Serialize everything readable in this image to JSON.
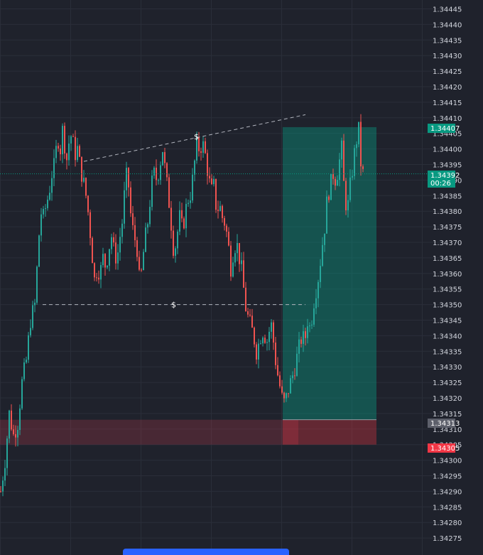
{
  "chart_data": {
    "type": "candlestick",
    "y_axis": {
      "ylim": [
        1.34273,
        1.34447
      ],
      "ticks": [
        "1.34445",
        "1.34440",
        "1.34435",
        "1.34430",
        "1.34425",
        "1.34420",
        "1.34415",
        "1.34410",
        "1.34405",
        "1.34400",
        "1.34395",
        "1.34390",
        "1.34385",
        "1.34380",
        "1.34375",
        "1.34370",
        "1.34365",
        "1.34360",
        "1.34355",
        "1.34350",
        "1.34345",
        "1.34340",
        "1.34335",
        "1.34330",
        "1.34325",
        "1.34320",
        "1.34315",
        "1.34310",
        "1.34305",
        "1.34300",
        "1.34295",
        "1.34290",
        "1.34285",
        "1.34280",
        "1.34275"
      ]
    },
    "price_badges": {
      "take_profit": "1.34407",
      "current": "1.34392",
      "countdown": "00:26",
      "entry": "1.34313",
      "stop_loss": "1.34305"
    },
    "close_path": [
      [
        0,
        1.3429
      ],
      [
        6,
        1.343
      ],
      [
        12,
        1.34315
      ],
      [
        18,
        1.34308
      ],
      [
        24,
        1.34312
      ],
      [
        30,
        1.34325
      ],
      [
        36,
        1.34332
      ],
      [
        42,
        1.34345
      ],
      [
        48,
        1.3435
      ],
      [
        52,
        1.34365
      ],
      [
        56,
        1.3438
      ],
      [
        60,
        1.34378
      ],
      [
        64,
        1.34382
      ],
      [
        68,
        1.34386
      ],
      [
        72,
        1.34392
      ],
      [
        76,
        1.34395
      ],
      [
        80,
        1.34404
      ],
      [
        84,
        1.344
      ],
      [
        88,
        1.34408
      ],
      [
        92,
        1.34395
      ],
      [
        96,
        1.34402
      ],
      [
        100,
        1.34405
      ],
      [
        104,
        1.34398
      ],
      [
        108,
        1.344
      ],
      [
        112,
        1.34394
      ],
      [
        116,
        1.3439
      ],
      [
        120,
        1.34385
      ],
      [
        124,
        1.34378
      ],
      [
        128,
        1.34368
      ],
      [
        132,
        1.34358
      ],
      [
        136,
        1.34362
      ],
      [
        140,
        1.3436
      ],
      [
        144,
        1.34365
      ],
      [
        148,
        1.34362
      ],
      [
        152,
        1.34368
      ],
      [
        156,
        1.34372
      ],
      [
        160,
        1.34366
      ],
      [
        164,
        1.34365
      ],
      [
        168,
        1.34372
      ],
      [
        172,
        1.34378
      ],
      [
        176,
        1.34392
      ],
      [
        180,
        1.34388
      ],
      [
        184,
        1.34376
      ],
      [
        188,
        1.34372
      ],
      [
        192,
        1.34368
      ],
      [
        196,
        1.34355
      ],
      [
        200,
        1.34365
      ],
      [
        204,
        1.34372
      ],
      [
        208,
        1.34378
      ],
      [
        212,
        1.34388
      ],
      [
        216,
        1.34392
      ],
      [
        220,
        1.3439
      ],
      [
        224,
        1.34395
      ],
      [
        228,
        1.344
      ],
      [
        232,
        1.34392
      ],
      [
        236,
        1.34385
      ],
      [
        240,
        1.34376
      ],
      [
        244,
        1.34366
      ],
      [
        248,
        1.34372
      ],
      [
        252,
        1.34378
      ],
      [
        256,
        1.34374
      ],
      [
        260,
        1.3438
      ],
      [
        264,
        1.34384
      ],
      [
        268,
        1.34386
      ],
      [
        272,
        1.34394
      ],
      [
        276,
        1.34401
      ],
      [
        280,
        1.344
      ],
      [
        284,
        1.34402
      ],
      [
        288,
        1.34398
      ],
      [
        292,
        1.34392
      ],
      [
        296,
        1.34386
      ],
      [
        300,
        1.34388
      ],
      [
        304,
        1.3438
      ],
      [
        308,
        1.34382
      ],
      [
        312,
        1.34378
      ],
      [
        316,
        1.34376
      ],
      [
        320,
        1.3437
      ],
      [
        324,
        1.34362
      ],
      [
        328,
        1.34368
      ],
      [
        332,
        1.3437
      ],
      [
        336,
        1.34365
      ],
      [
        340,
        1.3436
      ],
      [
        344,
        1.3435
      ],
      [
        348,
        1.34346
      ],
      [
        352,
        1.34343
      ],
      [
        356,
        1.3434
      ],
      [
        360,
        1.34335
      ],
      [
        364,
        1.34338
      ],
      [
        368,
        1.34342
      ],
      [
        372,
        1.3434
      ],
      [
        376,
        1.34338
      ],
      [
        380,
        1.34345
      ],
      [
        384,
        1.34338
      ],
      [
        388,
        1.3433
      ],
      [
        392,
        1.34325
      ],
      [
        396,
        1.3432
      ],
      [
        400,
        1.34318
      ],
      [
        404,
        1.34322
      ],
      [
        408,
        1.34325
      ],
      [
        412,
        1.34328
      ],
      [
        416,
        1.34332
      ],
      [
        420,
        1.34336
      ],
      [
        424,
        1.3434
      ],
      [
        428,
        1.34338
      ],
      [
        432,
        1.34345
      ],
      [
        436,
        1.34342
      ],
      [
        440,
        1.3435
      ],
      [
        444,
        1.34355
      ],
      [
        448,
        1.3436
      ],
      [
        452,
        1.34368
      ],
      [
        456,
        1.34375
      ],
      [
        460,
        1.34385
      ],
      [
        464,
        1.34388
      ],
      [
        468,
        1.34392
      ],
      [
        472,
        1.3439
      ],
      [
        476,
        1.34395
      ],
      [
        480,
        1.344
      ],
      [
        484,
        1.34385
      ],
      [
        488,
        1.3438
      ],
      [
        492,
        1.34388
      ],
      [
        496,
        1.34395
      ],
      [
        500,
        1.34402
      ],
      [
        504,
        1.34406
      ],
      [
        508,
        1.34392
      ]
    ],
    "annotations": {
      "upper_trendline": {
        "x": [
          118,
          430
        ],
        "y": [
          1.34396,
          1.34411
        ]
      },
      "lower_level": {
        "x": [
          60,
          430
        ],
        "y": [
          1.3435,
          1.3435
        ]
      },
      "dollar_markers": [
        {
          "label": "$",
          "x": 276,
          "y": 1.34404
        },
        {
          "label": "$",
          "x": 244,
          "y": 1.3435
        }
      ],
      "take_profit_zone": {
        "x": [
          398,
          530
        ],
        "y": [
          1.34313,
          1.34407
        ]
      },
      "stop_loss_zone": {
        "x": [
          398,
          530
        ],
        "y": [
          1.34305,
          1.34313
        ]
      },
      "supply_zone": {
        "x": [
          0,
          420
        ],
        "y": [
          1.34305,
          1.34313
        ]
      },
      "current_price_line": 1.34392
    },
    "grid": true
  },
  "colors": {
    "background": "#1f222c",
    "grid": "#2a2e39",
    "up": "#26a69a",
    "down": "#ef5350",
    "take_profit": "#089981",
    "stop_loss": "#f23645",
    "entry_badge": "#5d606b"
  }
}
